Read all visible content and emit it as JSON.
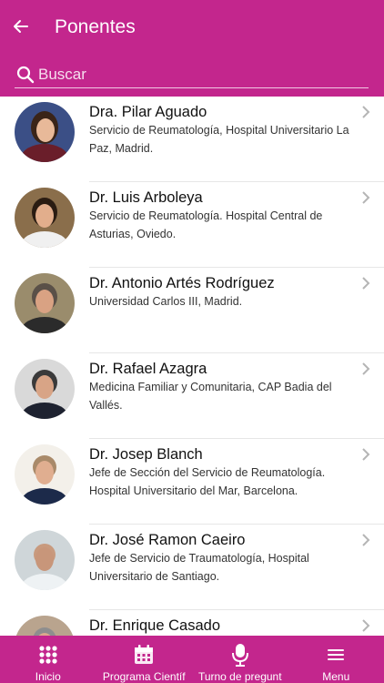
{
  "header": {
    "title": "Ponentes",
    "back_icon": "arrow-left-icon"
  },
  "search": {
    "placeholder": "Buscar",
    "value": "",
    "icon": "search-icon"
  },
  "speakers": [
    {
      "name": "Dra. Pilar Aguado",
      "description": " Servicio de Reumatología, Hospital Universitario La Paz, Madrid."
    },
    {
      "name": "Dr. Luis Arboleya",
      "description": " Servicio de Reumatología. Hospital Central de Asturias, Oviedo."
    },
    {
      "name": "Dr. Antonio Artés Rodríguez",
      "description": " Universidad Carlos III, Madrid."
    },
    {
      "name": "Dr. Rafael Azagra",
      "description": " Medicina Familiar y Comunitaria, CAP Badia del Vallés."
    },
    {
      "name": "Dr. Josep Blanch",
      "description": " Jefe de Sección del Servicio de Reumatología. Hospital Universitario del Mar, Barcelona."
    },
    {
      "name": "Dr. José Ramon Caeiro",
      "description": " Jefe de Servicio de Traumatología, Hospital Universitario de Santiago."
    },
    {
      "name": "Dr. Enrique Casado",
      "description": ""
    }
  ],
  "tabbar": {
    "items": [
      {
        "label": "Inicio",
        "icon": "grid-icon"
      },
      {
        "label": "Programa Científ",
        "icon": "calendar-icon"
      },
      {
        "label": "Turno de pregunt",
        "icon": "microphone-icon"
      },
      {
        "label": "Menu",
        "icon": "menu-icon"
      }
    ]
  },
  "colors": {
    "brand": "#c3268d"
  }
}
